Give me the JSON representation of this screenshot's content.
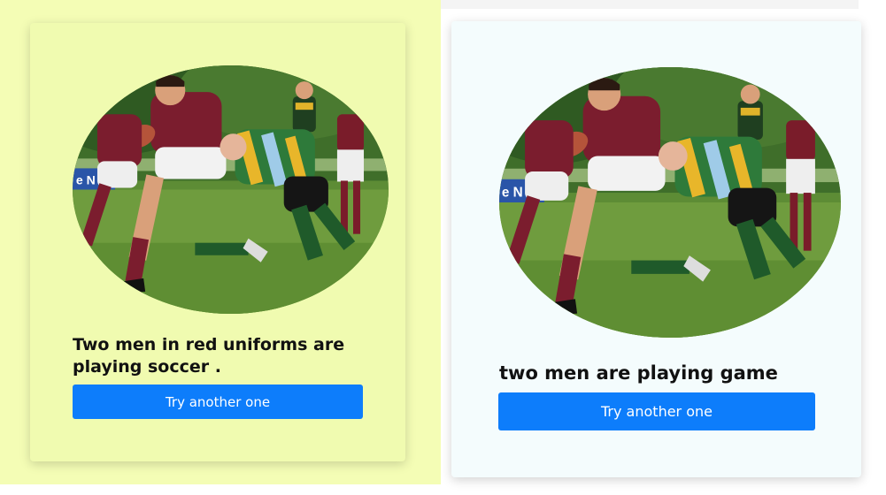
{
  "panels": [
    {
      "caption": "Two men in red uniforms are playing soccer .",
      "button_label": "Try another one",
      "image": "rugby-players-tackle-photo",
      "background": "#f4fdb5"
    },
    {
      "caption": "two men are playing game",
      "button_label": "Try another one",
      "image": "rugby-players-tackle-photo",
      "background": "#f4fcfd"
    }
  ],
  "colors": {
    "button": "#0d7dfb",
    "left_pane": "#f4fdb5",
    "right_card": "#f4fcfd"
  }
}
